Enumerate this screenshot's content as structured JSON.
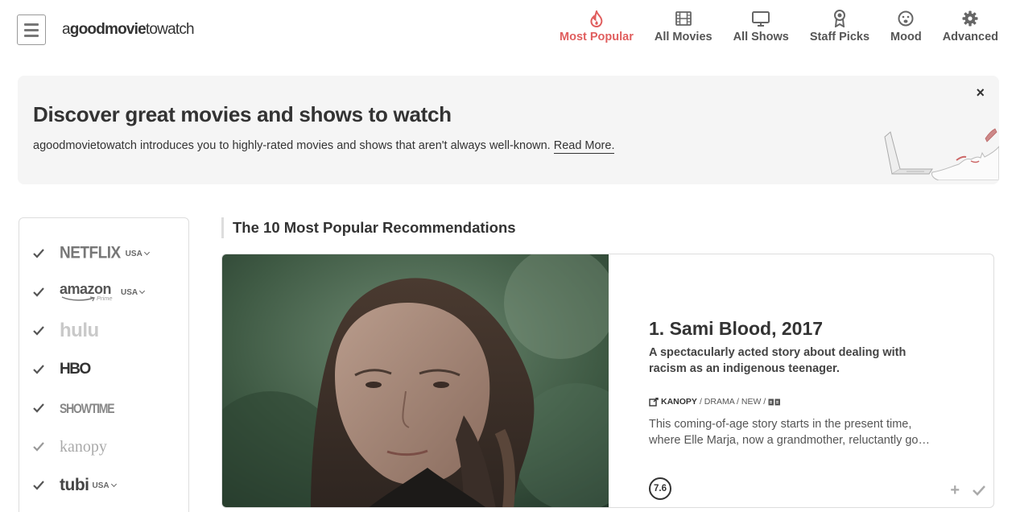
{
  "header": {
    "logo_light_1": "a",
    "logo_bold": "goodmovie",
    "logo_light_2": "towatch",
    "nav": [
      {
        "label": "Most Popular",
        "icon": "flame-icon",
        "active": true
      },
      {
        "label": "All Movies",
        "icon": "film-icon"
      },
      {
        "label": "All Shows",
        "icon": "tv-icon"
      },
      {
        "label": "Staff Picks",
        "icon": "award-icon"
      },
      {
        "label": "Mood",
        "icon": "mood-face-icon"
      },
      {
        "label": "Advanced",
        "icon": "gear-icon"
      }
    ]
  },
  "banner": {
    "title": "Discover great movies and shows to watch",
    "text": "agoodmovietowatch introduces you to highly-rated movies and shows that aren't always well-known.",
    "link": "Read More.",
    "close": "×"
  },
  "sidebar": {
    "services": [
      {
        "name": "NETFLIX",
        "region": "USA"
      },
      {
        "name": "amazon",
        "sub": "Prime",
        "region": "USA"
      },
      {
        "name": "hulu"
      },
      {
        "name": "HBO"
      },
      {
        "name": "SHOWTIME"
      },
      {
        "name": "kanopy"
      },
      {
        "name": "tubi",
        "region": "USA"
      }
    ]
  },
  "section": {
    "heading": "The 10 Most Popular Recommendations"
  },
  "card": {
    "title": "1. Sami Blood, 2017",
    "tagline": "A spectacularly acted story about dealing with racism as an indigenous teenager.",
    "meta_service": "KANOPY",
    "meta_rest": "/ DRAMA / NEW /",
    "desc_line1": "This coming-of-age story starts in the present time,",
    "desc_line2": "where Elle Marja, now a grandmother, reluctantly go…",
    "rating": "7.6",
    "add": "+"
  },
  "colors": {
    "accent": "#e05e5e",
    "text": "#333333",
    "banner_bg": "#f5f5f5"
  }
}
